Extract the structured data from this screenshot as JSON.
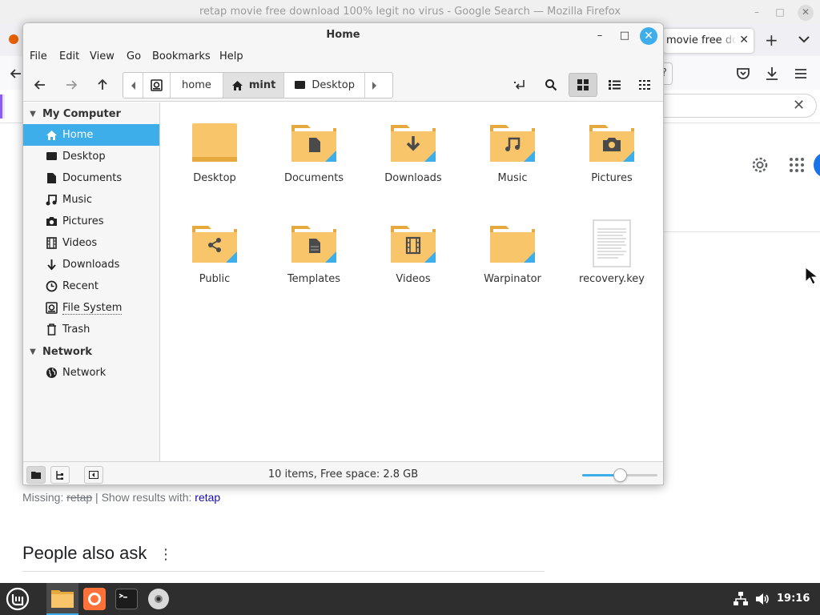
{
  "firefox": {
    "window_title": "retap movie free download 100% legit no virus - Google Search — Mozilla Firefox",
    "tab_title": "movie free download",
    "tab_close": "✕",
    "new_tab": "+",
    "url_fragment": "?",
    "find_clear": "✕",
    "missing_prefix": "Missing: ",
    "missing_word": "retap",
    "missing_sep": " | Show results with: ",
    "missing_link": "retap",
    "paa_title": "People also ask",
    "paa_menu": "⋮",
    "win_min": "–",
    "win_max": "□",
    "win_close": "✕"
  },
  "nemo": {
    "title": "Home",
    "win_min": "–",
    "win_max": "□",
    "win_close": "✕",
    "menu": [
      "File",
      "Edit",
      "View",
      "Go",
      "Bookmarks",
      "Help"
    ],
    "path": [
      "home",
      "mint",
      "Desktop"
    ],
    "sidebar": {
      "section1": "My Computer",
      "items1": [
        "Home",
        "Desktop",
        "Documents",
        "Music",
        "Pictures",
        "Videos",
        "Downloads",
        "Recent",
        "File System",
        "Trash"
      ],
      "section2": "Network",
      "items2": [
        "Network"
      ]
    },
    "files": [
      "Desktop",
      "Documents",
      "Downloads",
      "Music",
      "Pictures",
      "Public",
      "Templates",
      "Videos",
      "Warpinator",
      "recovery.key"
    ],
    "status": "10 items, Free space: 2.8 GB",
    "zoom_level": 0.5
  },
  "taskbar": {
    "clock": "19:16"
  },
  "colors": {
    "accent": "#3daee9",
    "folder": "#f8c56b",
    "folder_dark": "#e5a93e",
    "taskbar": "#2e2e2e"
  }
}
